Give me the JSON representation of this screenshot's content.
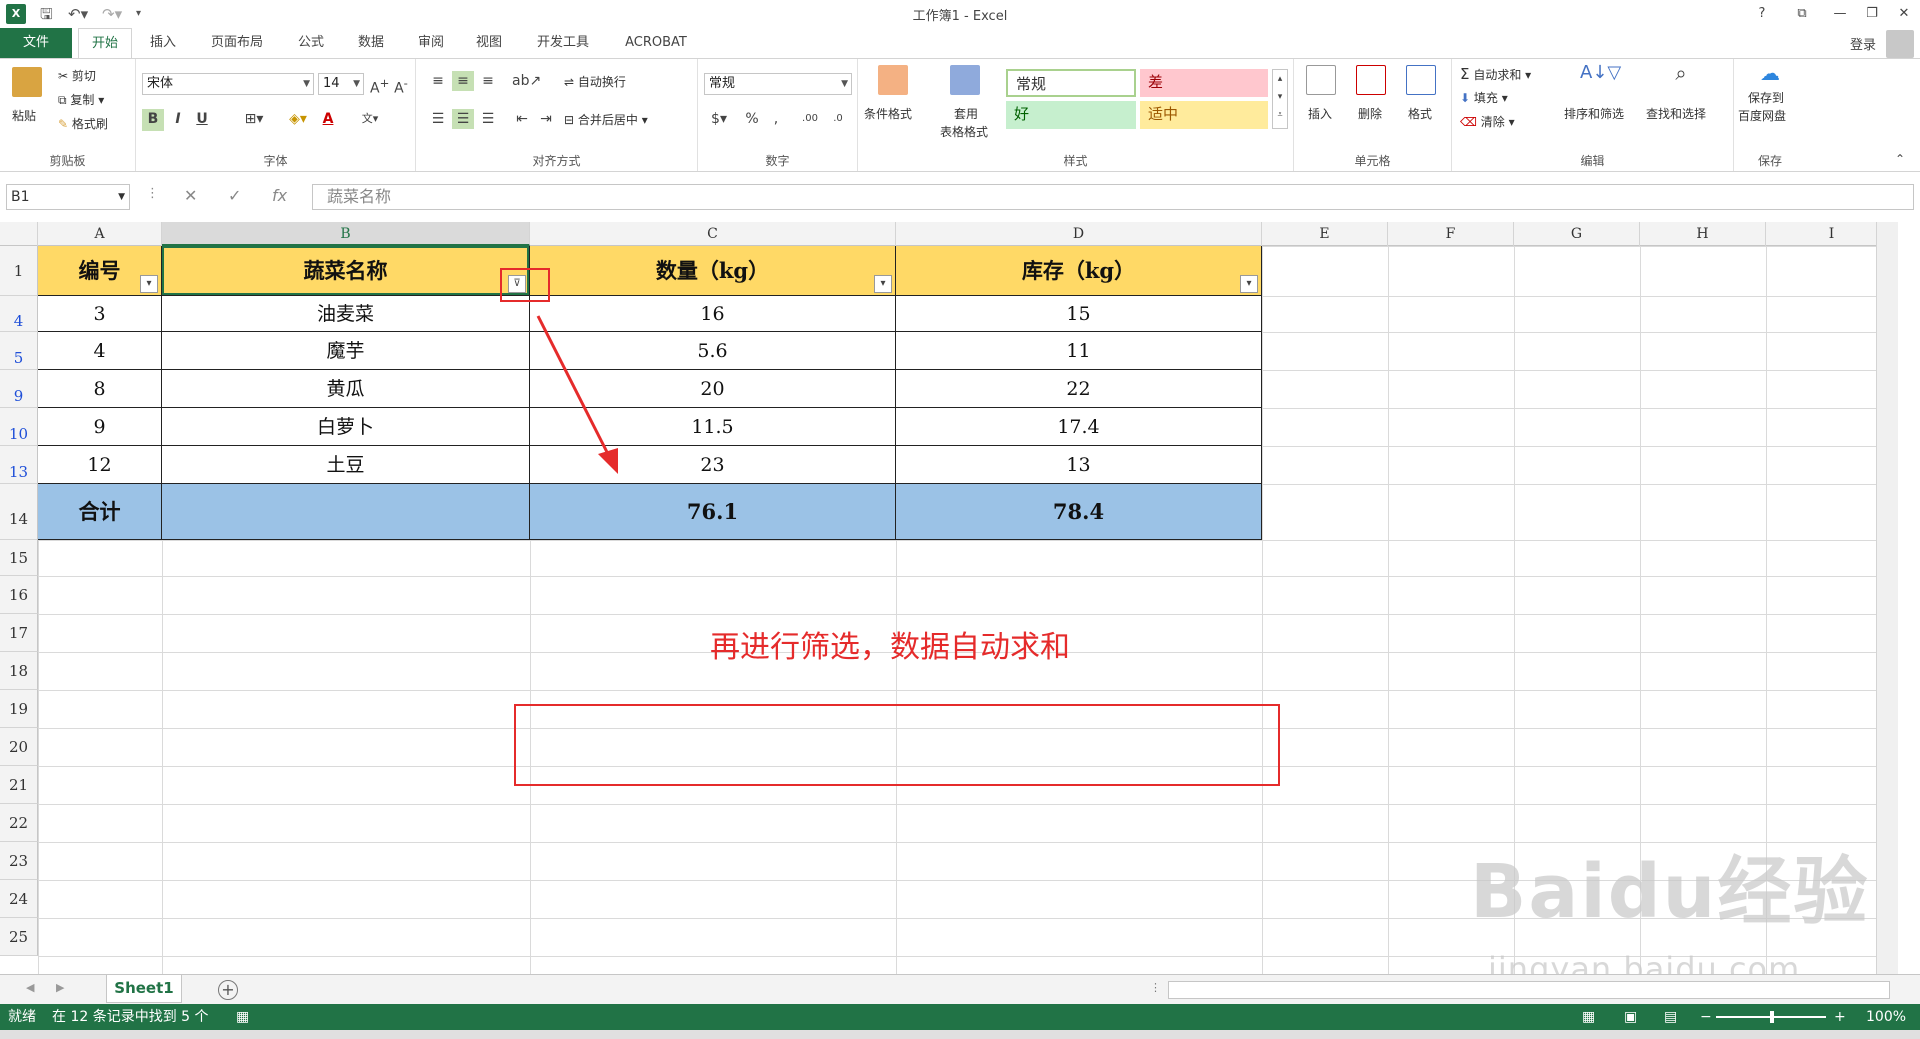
{
  "window": {
    "title": "工作簿1 - Excel",
    "help": "?",
    "login": "登录"
  },
  "tabs": [
    "文件",
    "开始",
    "插入",
    "页面布局",
    "公式",
    "数据",
    "审阅",
    "视图",
    "开发工具",
    "ACROBAT"
  ],
  "ribbon": {
    "clipboard": {
      "label": "剪贴板",
      "paste": "粘贴",
      "cut": "剪切",
      "copy": "复制",
      "format_painter": "格式刷"
    },
    "font": {
      "label": "字体",
      "name": "宋体",
      "size": "14",
      "bold": "B",
      "italic": "I",
      "underline": "U",
      "font_color": "A"
    },
    "alignment": {
      "label": "对齐方式",
      "wrap": "自动换行",
      "merge": "合并后居中"
    },
    "number": {
      "label": "数字",
      "format": "常规",
      "percent": "%"
    },
    "styles": {
      "label": "样式",
      "conditional": "条件格式",
      "table_format_1": "套用",
      "table_format_2": "表格格式",
      "normal": "常规",
      "bad": "差",
      "good": "好",
      "neutral": "适中"
    },
    "cells": {
      "label": "单元格",
      "insert": "插入",
      "delete": "删除",
      "format": "格式"
    },
    "editing": {
      "label": "编辑",
      "autosum": "自动求和",
      "fill": "填充",
      "clear": "清除",
      "sort": "排序和筛选",
      "find": "查找和选择"
    },
    "save": {
      "label": "保存",
      "save_1": "保存到",
      "save_2": "百度网盘"
    }
  },
  "formula_bar": {
    "name_box": "B1",
    "fx": "fx",
    "value": "蔬菜名称"
  },
  "columns": [
    "A",
    "B",
    "C",
    "D",
    "E",
    "F",
    "G",
    "H",
    "I"
  ],
  "row_numbers": [
    "1",
    "4",
    "5",
    "9",
    "10",
    "13",
    "14",
    "15",
    "16",
    "17",
    "18",
    "19",
    "20",
    "21",
    "22",
    "23",
    "24",
    "25"
  ],
  "table": {
    "headers": [
      "编号",
      "蔬菜名称",
      "数量（kg）",
      "库存（kg）"
    ],
    "rows": [
      [
        "3",
        "油麦菜",
        "16",
        "15"
      ],
      [
        "4",
        "魔芋",
        "5.6",
        "11"
      ],
      [
        "8",
        "黄瓜",
        "20",
        "22"
      ],
      [
        "9",
        "白萝卜",
        "11.5",
        "17.4"
      ],
      [
        "12",
        "土豆",
        "23",
        "13"
      ]
    ],
    "total": [
      "合计",
      "",
      "76.1",
      "78.4"
    ]
  },
  "sheet_tab": "Sheet1",
  "status": {
    "ready": "就绪",
    "filter_info": "在 12 条记录中找到 5 个",
    "zoom": "100%"
  },
  "annotation": "再进行筛选，数据自动求和",
  "watermark": {
    "main": "Baidu经验",
    "sub": "jingyan.baidu.com"
  },
  "colors": {
    "accent": "#217346",
    "header_fill": "#ffd966",
    "total_fill": "#9bc2e6",
    "annotation": "#e52b2b"
  }
}
